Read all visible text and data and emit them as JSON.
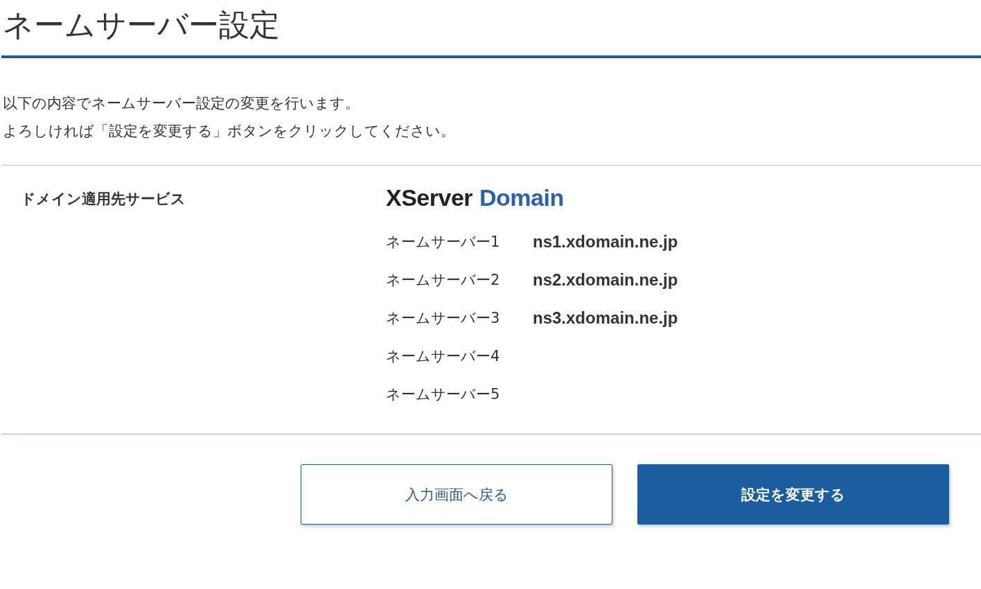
{
  "page_title": "ネームサーバー設定",
  "intro": [
    "以下の内容でネームサーバー設定の変更を行います。",
    "よろしければ「設定を変更する」ボタンをクリックしてください。"
  ],
  "service": {
    "label": "ドメイン適用先サービス",
    "logo": {
      "part_1": "XServer",
      "part_2": "Domain"
    },
    "nameservers": [
      {
        "label": "ネームサーバー1",
        "value": "ns1.xdomain.ne.jp"
      },
      {
        "label": "ネームサーバー2",
        "value": "ns2.xdomain.ne.jp"
      },
      {
        "label": "ネームサーバー3",
        "value": "ns3.xdomain.ne.jp"
      },
      {
        "label": "ネームサーバー4"
      },
      {
        "label": "ネームサーバー5"
      }
    ]
  },
  "buttons": [
    {
      "label": "入力画面へ戻る",
      "kind": "secondary"
    },
    {
      "label": "設定を変更する",
      "kind": "primary"
    }
  ]
}
